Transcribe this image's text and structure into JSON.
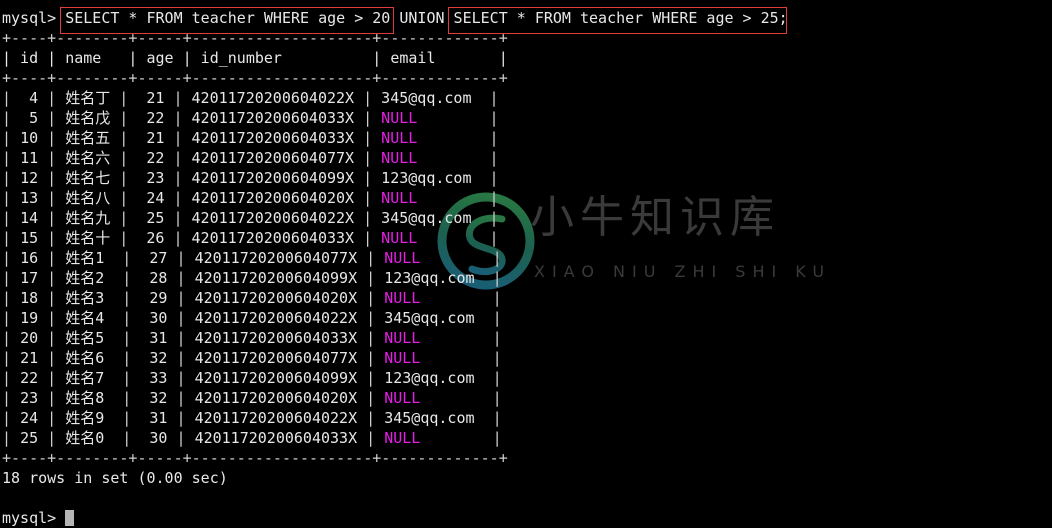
{
  "terminal": {
    "prompt": "mysql>",
    "command_prefix": "mysql> ",
    "query_part_1": "SELECT * FROM teacher WHERE age > 20",
    "query_separator": " UNION ",
    "query_part_2": "SELECT * FROM teacher WHERE age > 25;",
    "status_line": "18 rows in set (0.00 sec)",
    "final_prompt": "mysql> ",
    "highlight_color": "#e03c3c",
    "null_color": "#e61ee6",
    "text_color": "#e8e8e8",
    "background_color": "#000000"
  },
  "table": {
    "border_top": "+----+--------+-----+--------------------+-------------+",
    "border_header": "+----+--------+-----+--------------------+-------------+",
    "border_bottom": "+----+--------+-----+--------------------+-------------+",
    "columns": [
      "id",
      "name",
      "age",
      "id_number",
      "email"
    ],
    "header_row": "| id | name   | age | id_number          | email       |",
    "rows": [
      {
        "id": "4",
        "name": "姓名丁",
        "age": "21",
        "id_number": "42011720200604022X",
        "email": "345@qq.com"
      },
      {
        "id": "5",
        "name": "姓名戊",
        "age": "22",
        "id_number": "42011720200604033X",
        "email": "NULL"
      },
      {
        "id": "10",
        "name": "姓名五",
        "age": "21",
        "id_number": "42011720200604033X",
        "email": "NULL"
      },
      {
        "id": "11",
        "name": "姓名六",
        "age": "22",
        "id_number": "42011720200604077X",
        "email": "NULL"
      },
      {
        "id": "12",
        "name": "姓名七",
        "age": "23",
        "id_number": "42011720200604099X",
        "email": "123@qq.com"
      },
      {
        "id": "13",
        "name": "姓名八",
        "age": "24",
        "id_number": "42011720200604020X",
        "email": "NULL"
      },
      {
        "id": "14",
        "name": "姓名九",
        "age": "25",
        "id_number": "42011720200604022X",
        "email": "345@qq.com"
      },
      {
        "id": "15",
        "name": "姓名十",
        "age": "26",
        "id_number": "42011720200604033X",
        "email": "NULL"
      },
      {
        "id": "16",
        "name": "姓名1",
        "age": "27",
        "id_number": "42011720200604077X",
        "email": "NULL"
      },
      {
        "id": "17",
        "name": "姓名2",
        "age": "28",
        "id_number": "42011720200604099X",
        "email": "123@qq.com"
      },
      {
        "id": "18",
        "name": "姓名3",
        "age": "29",
        "id_number": "42011720200604020X",
        "email": "NULL"
      },
      {
        "id": "19",
        "name": "姓名4",
        "age": "30",
        "id_number": "42011720200604022X",
        "email": "345@qq.com"
      },
      {
        "id": "20",
        "name": "姓名5",
        "age": "31",
        "id_number": "42011720200604033X",
        "email": "NULL"
      },
      {
        "id": "21",
        "name": "姓名6",
        "age": "32",
        "id_number": "42011720200604077X",
        "email": "NULL"
      },
      {
        "id": "22",
        "name": "姓名7",
        "age": "33",
        "id_number": "42011720200604099X",
        "email": "123@qq.com"
      },
      {
        "id": "23",
        "name": "姓名8",
        "age": "32",
        "id_number": "42011720200604020X",
        "email": "NULL"
      },
      {
        "id": "24",
        "name": "姓名9",
        "age": "31",
        "id_number": "42011720200604022X",
        "email": "345@qq.com"
      },
      {
        "id": "25",
        "name": "姓名0",
        "age": "30",
        "id_number": "42011720200604033X",
        "email": "NULL"
      }
    ]
  },
  "watermark": {
    "text_cn": "小牛知识库",
    "text_pinyin": "XIAO NIU ZHI SHI KU",
    "logo_gradient_start": "#2e8b4f",
    "logo_gradient_end": "#1f6f8b"
  }
}
